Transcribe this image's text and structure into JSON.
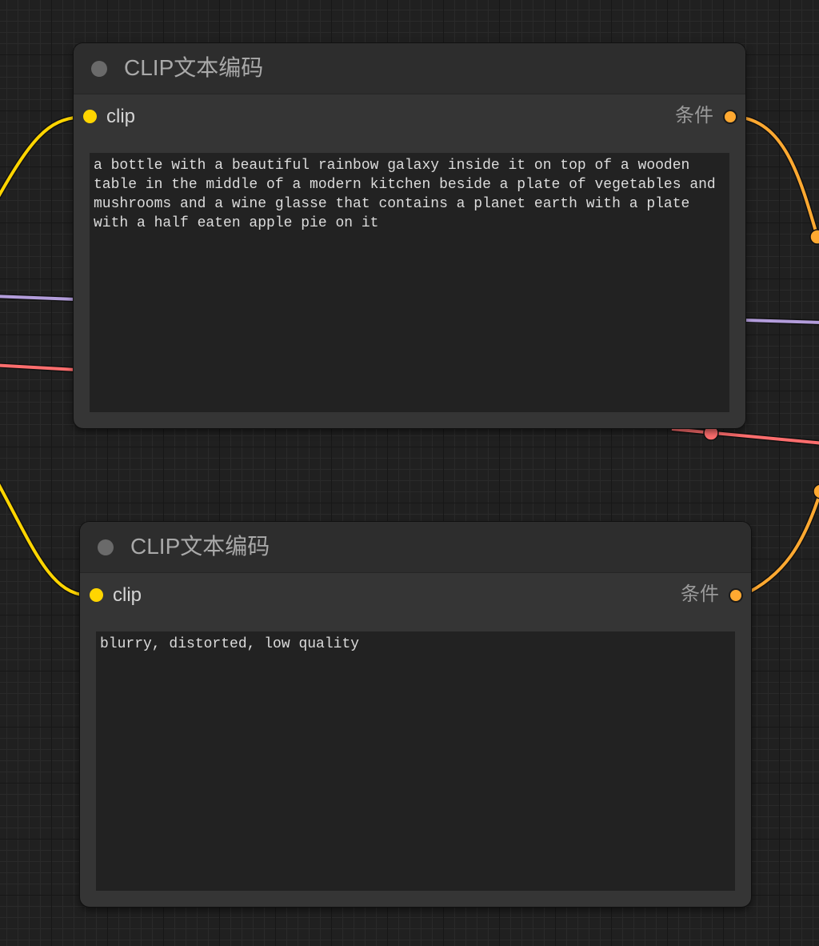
{
  "colors": {
    "clip_link": "#ffd500",
    "conditioning_link": "#ffa931",
    "model_link": "#b39ddb",
    "latent_link": "#ff6e6e"
  },
  "nodes": [
    {
      "title": "CLIP文本编码",
      "input_label": "clip",
      "output_label": "条件",
      "text": "a bottle with a beautiful rainbow galaxy inside it on top of a wooden table in the middle of a modern kitchen beside a plate of vegetables and mushrooms and a wine glasse that contains a planet earth with a plate with a half eaten apple pie on it"
    },
    {
      "title": "CLIP文本编码",
      "input_label": "clip",
      "output_label": "条件",
      "text": "blurry, distorted, low quality"
    }
  ]
}
